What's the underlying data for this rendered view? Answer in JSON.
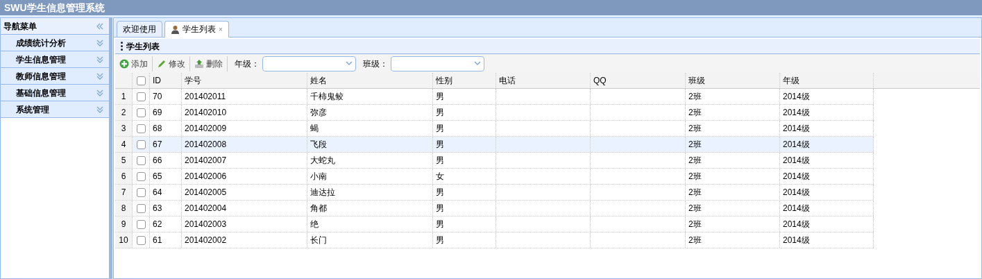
{
  "app_title": "SWU学生信息管理系统",
  "sidebar": {
    "title": "导航菜单",
    "items": [
      {
        "label": "成绩统计分析",
        "expanded": false
      },
      {
        "label": "学生信息管理",
        "expanded": false
      },
      {
        "label": "教师信息管理",
        "expanded": false
      },
      {
        "label": "基础信息管理",
        "expanded": false
      },
      {
        "label": "系统管理",
        "expanded": false
      }
    ]
  },
  "tabs": [
    {
      "label": "欢迎使用",
      "selected": false,
      "closable": false,
      "has_icon": false
    },
    {
      "label": "学生列表",
      "selected": true,
      "closable": true,
      "has_icon": true,
      "close": "×"
    }
  ],
  "panel_title": "学生列表",
  "toolbar": {
    "buttons": [
      {
        "label": "添加",
        "kind": "add"
      },
      {
        "label": "修改",
        "kind": "edit"
      },
      {
        "label": "删除",
        "kind": "delete"
      }
    ],
    "filters": [
      {
        "label": "年级："
      },
      {
        "label": "班级："
      }
    ]
  },
  "table": {
    "select_all_checked": false,
    "columns": [
      "ID",
      "学号",
      "姓名",
      "性别",
      "电话",
      "QQ",
      "班级",
      "年级"
    ],
    "rows": [
      {
        "number": "1",
        "checked": false,
        "selected": false,
        "cells": [
          "70",
          "201402011",
          "千柿鬼鲛",
          "男",
          null,
          null,
          "2班",
          "2014级"
        ]
      },
      {
        "number": "2",
        "checked": false,
        "selected": false,
        "cells": [
          "69",
          "201402010",
          "弥彦",
          "男",
          null,
          null,
          "2班",
          "2014级"
        ]
      },
      {
        "number": "3",
        "checked": false,
        "selected": false,
        "cells": [
          "68",
          "201402009",
          "蝎",
          "男",
          null,
          null,
          "2班",
          "2014级"
        ]
      },
      {
        "number": "4",
        "checked": false,
        "selected": true,
        "cells": [
          "67",
          "201402008",
          "飞段",
          "男",
          null,
          null,
          "2班",
          "2014级"
        ]
      },
      {
        "number": "5",
        "checked": false,
        "selected": false,
        "cells": [
          "66",
          "201402007",
          "大蛇丸",
          "男",
          null,
          null,
          "2班",
          "2014级"
        ]
      },
      {
        "number": "6",
        "checked": false,
        "selected": false,
        "cells": [
          "65",
          "201402006",
          "小南",
          "女",
          null,
          null,
          "2班",
          "2014级"
        ]
      },
      {
        "number": "7",
        "checked": false,
        "selected": false,
        "cells": [
          "64",
          "201402005",
          "迪达拉",
          "男",
          null,
          null,
          "2班",
          "2014级"
        ]
      },
      {
        "number": "8",
        "checked": false,
        "selected": false,
        "cells": [
          "63",
          "201402004",
          "角都",
          "男",
          null,
          null,
          "2班",
          "2014级"
        ]
      },
      {
        "number": "9",
        "checked": false,
        "selected": false,
        "cells": [
          "62",
          "201402003",
          "绝",
          "男",
          null,
          null,
          "2班",
          "2014级"
        ]
      },
      {
        "number": "10",
        "checked": false,
        "selected": false,
        "cells": [
          "61",
          "201402002",
          "长门",
          "男",
          null,
          null,
          "2班",
          "2014级"
        ]
      }
    ]
  }
}
